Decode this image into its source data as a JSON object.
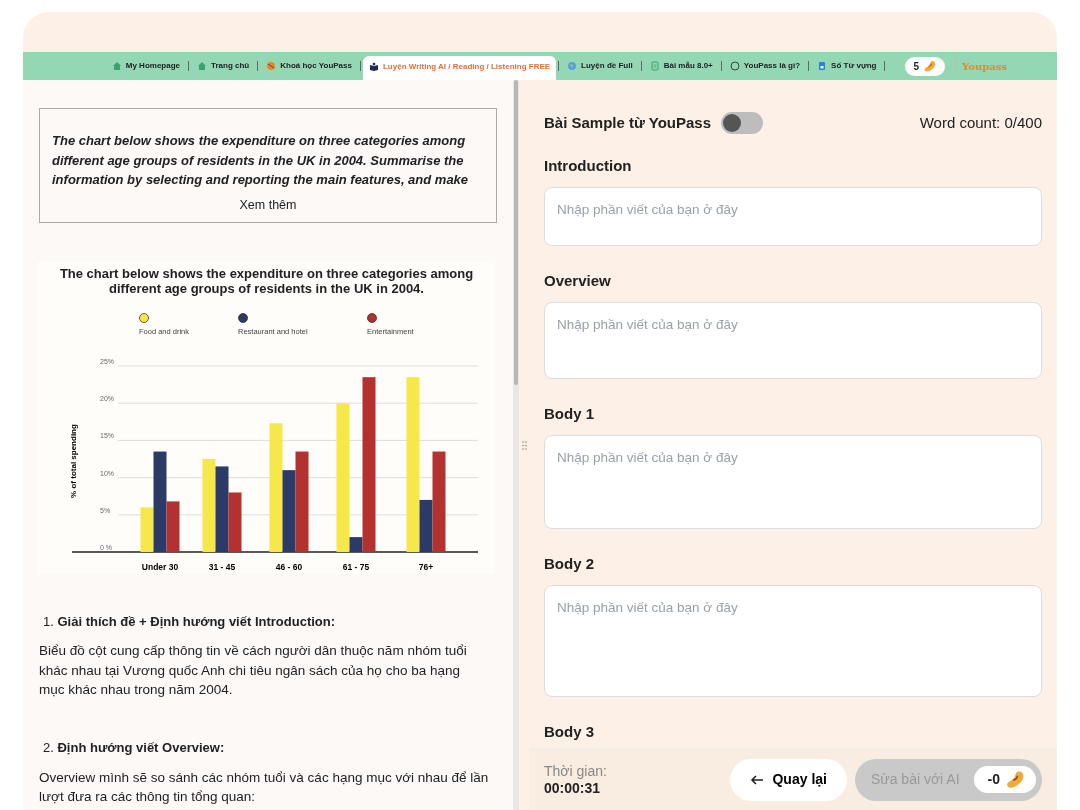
{
  "nav_tabs": [
    {
      "label": "My Homepage",
      "selected": false
    },
    {
      "label": "Trang chủ",
      "selected": false
    },
    {
      "label": "Khoá học YouPass",
      "selected": false
    },
    {
      "label": "Luyện Writing AI / Reading / Listening FREE",
      "selected": true
    },
    {
      "label": "Luyện đề Full",
      "selected": false
    },
    {
      "label": "Bài mẫu 8.0+",
      "selected": false
    },
    {
      "label": "YouPass là gì?",
      "selected": false
    },
    {
      "label": "Sổ Từ vựng",
      "selected": false
    }
  ],
  "coin_count": "5",
  "logo_text": "Youpass",
  "prompt": {
    "text": "The chart below shows the expenditure on three categories among different age groups of residents in the UK in 2004. Summarise the information by selecting and reporting the main features, and make",
    "more_link": "Xem thêm"
  },
  "chart_data": {
    "type": "bar",
    "title": "The chart below shows the expenditure on three categories among different age groups of residents in the UK in 2004.",
    "ylabel": "% of total spending",
    "categories": [
      "Under 30",
      "31 - 45",
      "46 - 60",
      "61 - 75",
      "76+"
    ],
    "series": [
      {
        "name": "Food and drink",
        "color": "#f7e84a",
        "values": [
          6,
          12.5,
          17.3,
          20,
          23.5
        ]
      },
      {
        "name": "Restaurant and hotel",
        "color": "#2b3a67",
        "values": [
          13.5,
          11.5,
          11,
          2,
          7
        ]
      },
      {
        "name": "Entertainment",
        "color": "#b3312f",
        "values": [
          6.8,
          8,
          13.5,
          23.5,
          13.5
        ]
      }
    ],
    "ylim": [
      0,
      25
    ],
    "grid": true,
    "legend": true,
    "yticks": [
      {
        "value": 0,
        "label": "0 %"
      },
      {
        "value": 5,
        "label": "5%"
      },
      {
        "value": 10,
        "label": "10%"
      },
      {
        "value": 15,
        "label": "15%"
      },
      {
        "value": 20,
        "label": "20%"
      },
      {
        "value": 25,
        "label": "25%"
      }
    ]
  },
  "guide": [
    {
      "heading": "1. **Giải thích đề + Định hướng viết Introduction:**",
      "text": "Biểu đồ cột cung cấp thông tin về cách người dân thuộc năm nhóm tuổi khác nhau tại Vương quốc Anh chi tiêu ngân sách của họ cho ba hạng mục khác nhau trong năm 2004."
    },
    {
      "heading": "2. **Định hướng viết Overview:**",
      "text": "Overview mình sẽ so sánh các nhóm tuổi và các hạng mục với nhau để lần lượt đưa ra các thông tin tổng quan:"
    }
  ],
  "sample_toggle": {
    "label": "Bài Sample từ YouPass",
    "on": false
  },
  "word_count": "Word count: 0/400",
  "sections": [
    {
      "label": "Introduction",
      "placeholder": "Nhập phần viết của bạn ở đây"
    },
    {
      "label": "Overview",
      "placeholder": "Nhập phần viết của bạn ở đây"
    },
    {
      "label": "Body 1",
      "placeholder": "Nhập phần viết của bạn ở đây"
    },
    {
      "label": "Body 2",
      "placeholder": "Nhập phần viết của bạn ở đây"
    },
    {
      "label": "Body 3"
    }
  ],
  "timer": {
    "label": "Thời gian:",
    "value": "00:00:31"
  },
  "back_button": "Quay lại",
  "ai_button": {
    "label": "Sửa bài với AI",
    "cost": "-0",
    "disabled": true
  }
}
